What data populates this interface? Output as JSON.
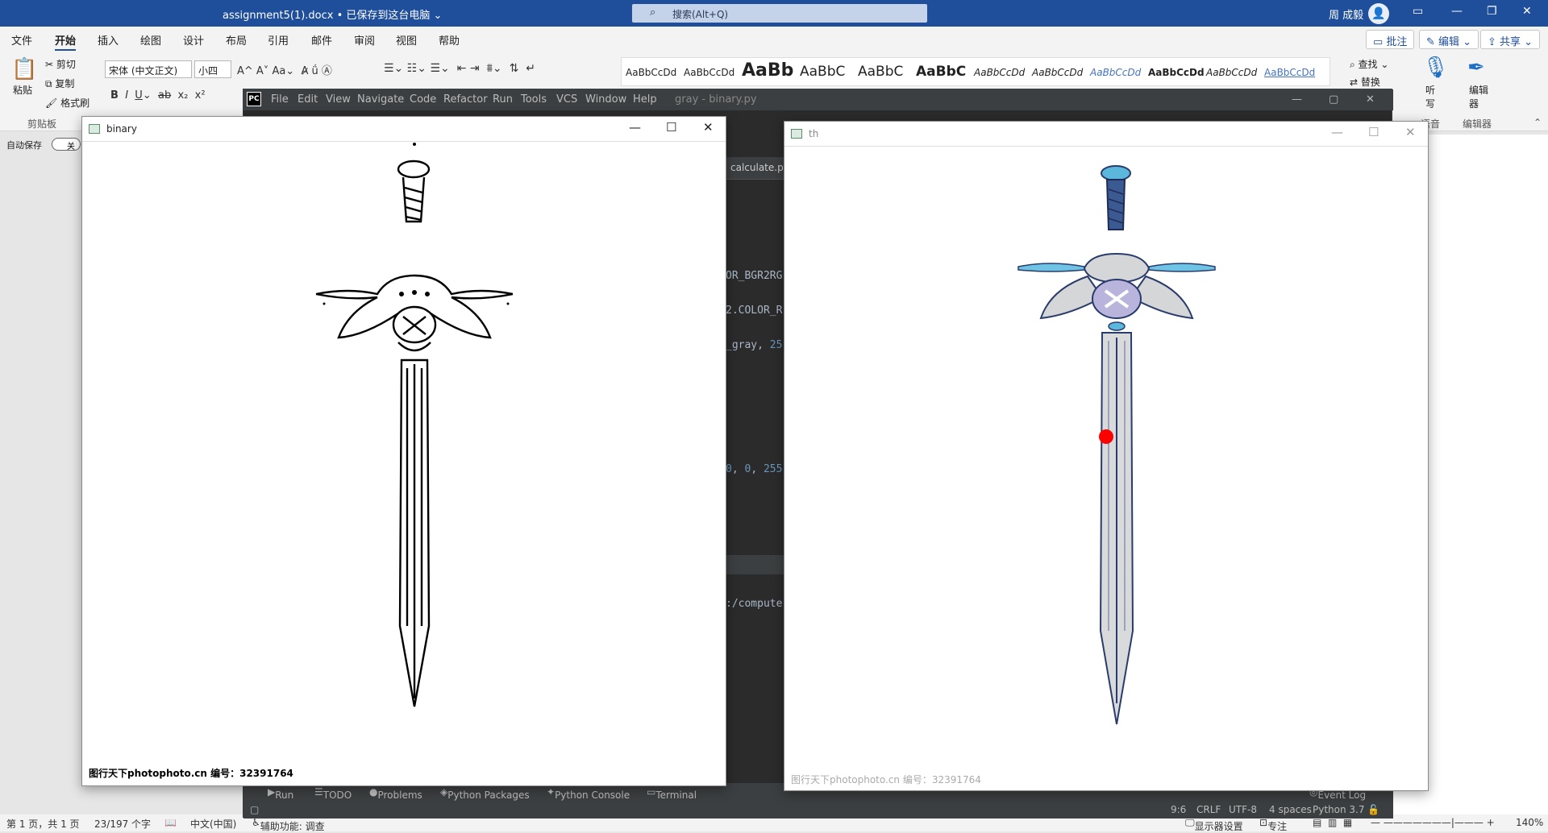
{
  "word": {
    "title": "assignment5(1).docx • 已保存到这台电脑 ⌄",
    "search_placeholder": "搜索(Alt+Q)",
    "user": "周 成毅",
    "tabs": [
      "文件",
      "开始",
      "插入",
      "绘图",
      "设计",
      "布局",
      "引用",
      "邮件",
      "审阅",
      "视图",
      "帮助"
    ],
    "right_buttons": {
      "comment": "批注",
      "edit": "编辑 ⌄",
      "share": "共享 ⌄"
    },
    "clipboard": {
      "paste": "粘贴",
      "cut": "剪切",
      "copy": "复制",
      "format": "格式刷",
      "group": "剪贴板"
    },
    "font": {
      "name": "宋体 (中文正文)",
      "size": "小四"
    },
    "styles": [
      "AaBbCcDd",
      "AaBbCcDd",
      "AaBb",
      "AaBbC",
      "AaBbC",
      "AaBbC",
      "AaBbCcDd",
      "AaBbCcDd",
      "AaBbCcDd",
      "AaBbCcDd",
      "AaBbCcDd",
      "AaBbCcDd"
    ],
    "find": "查找",
    "replace": "替换",
    "voice": {
      "dictate": "听写",
      "group": "语音"
    },
    "editor": {
      "label": "编辑器",
      "group": "编辑器"
    },
    "autosave": "自动保存",
    "autosave_state": "关",
    "status": {
      "page": "第 1 页，共 1 页",
      "words": "23/197 个字",
      "lang": "中文(中国)",
      "access": "辅助功能: 调查",
      "display": "显示器设置",
      "focus": "专注",
      "zoom": "140%"
    }
  },
  "pycharm": {
    "menu": [
      "File",
      "Edit",
      "View",
      "Navigate",
      "Code",
      "Refactor",
      "Run",
      "Tools",
      "VCS",
      "Window",
      "Help"
    ],
    "title": "gray - binary.py",
    "tab": "calculate.py",
    "code_lines": [
      {
        "text": "OR_BGR2RG"
      },
      {
        "text": "2.COLOR_R"
      },
      {
        "pre": "_gray, ",
        "num": "25"
      },
      {
        "pre": "",
        "num": "0",
        "mid": ", ",
        "num2": "0",
        "mid2": ", ",
        "num3": "255"
      }
    ],
    "console": ":/compute",
    "bottom_tabs": [
      "Run",
      "TODO",
      "Problems",
      "Python Packages",
      "Python Console",
      "Terminal"
    ],
    "event_log": "Event Log",
    "status": [
      "9:6",
      "CRLF",
      "UTF-8",
      "4 spaces",
      "Python 3.7"
    ]
  },
  "binary_window": {
    "title": "binary",
    "watermark": "图行天下photophoto.cn 编号：32391764"
  },
  "th_window": {
    "title": "th",
    "watermark": "图行天下photophoto.cn 编号：32391764"
  }
}
